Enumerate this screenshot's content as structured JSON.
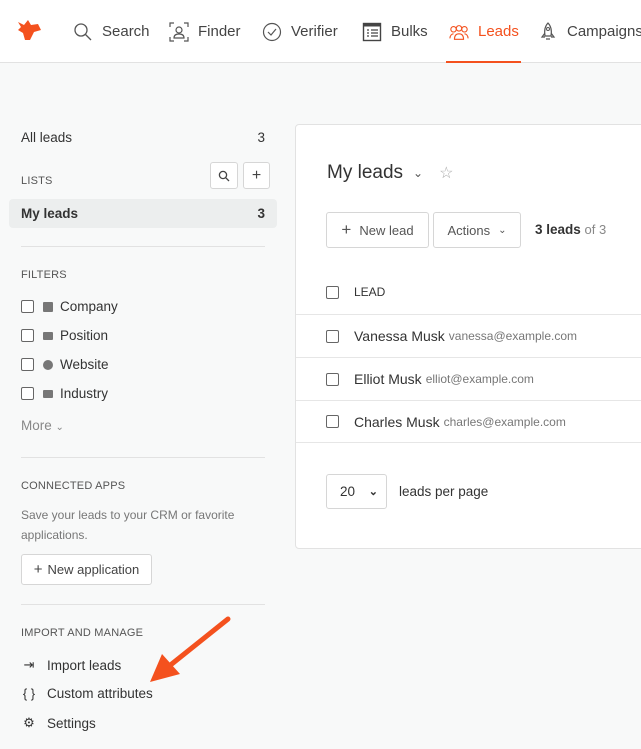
{
  "nav": {
    "items": [
      {
        "label": "Search",
        "icon": "search-icon"
      },
      {
        "label": "Finder",
        "icon": "finder-icon"
      },
      {
        "label": "Verifier",
        "icon": "check-circle-icon"
      },
      {
        "label": "Bulks",
        "icon": "list-icon"
      },
      {
        "label": "Leads",
        "icon": "leads-icon",
        "active": true
      },
      {
        "label": "Campaigns",
        "icon": "rocket-icon"
      }
    ],
    "accent": "#f4511e"
  },
  "sidebar": {
    "all_leads": {
      "label": "All leads",
      "count": "3"
    },
    "lists_title": "LISTS",
    "lists": [
      {
        "label": "My leads",
        "count": "3",
        "selected": true
      }
    ],
    "filters_title": "FILTERS",
    "filters": [
      {
        "label": "Company",
        "icon": "building-icon"
      },
      {
        "label": "Position",
        "icon": "briefcase-icon"
      },
      {
        "label": "Website",
        "icon": "globe-icon"
      },
      {
        "label": "Industry",
        "icon": "factory-icon"
      }
    ],
    "more": "More",
    "apps_title": "CONNECTED APPS",
    "apps_desc": "Save your leads to your CRM or favorite applications.",
    "new_app": "New application",
    "manage_title": "IMPORT AND MANAGE",
    "manage": [
      {
        "label": "Import leads",
        "icon": "import-icon"
      },
      {
        "label": "Custom attributes",
        "icon": "braces-icon"
      },
      {
        "label": "Settings",
        "icon": "gear-icon"
      }
    ]
  },
  "main": {
    "title": "My leads",
    "new_lead": "New lead",
    "actions": "Actions",
    "count_bold": "3 leads",
    "count_rest": "of 3",
    "column": "LEAD",
    "leads": [
      {
        "name": "Vanessa Musk",
        "email": "vanessa@example.com"
      },
      {
        "name": "Elliot Musk",
        "email": "elliot@example.com"
      },
      {
        "name": "Charles Musk",
        "email": "charles@example.com"
      }
    ],
    "per_page": "20",
    "per_page_label": "leads per page"
  }
}
